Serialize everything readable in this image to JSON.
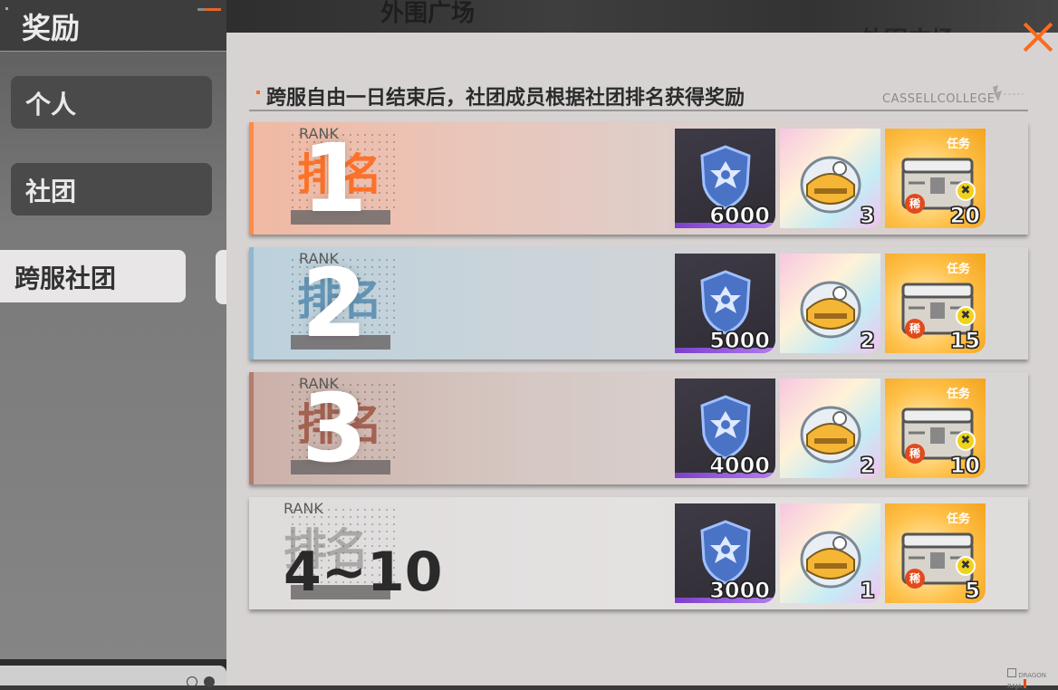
{
  "background": {
    "map_label_1": "外围广场",
    "map_label_2": "外围广场"
  },
  "sidebar": {
    "title": "奖励",
    "tabs": [
      {
        "label": "个人",
        "active": false
      },
      {
        "label": "社团",
        "active": false
      },
      {
        "label": "跨服社团",
        "active": true
      }
    ]
  },
  "header": {
    "description": "跨服自由一日结束后，社团成员根据社团排名获得奖励",
    "brand": "CASSELLCOLLEGE"
  },
  "item_labels": {
    "rare_tag": "稀",
    "task_tag": "任务"
  },
  "ranks": [
    {
      "rank_label": "RANK",
      "rank_name": "排名",
      "number": "1",
      "color": "#ff6a1c",
      "rewards": {
        "shield": "6000",
        "bag": "3",
        "chest": "20"
      }
    },
    {
      "rank_label": "RANK",
      "rank_name": "排名",
      "number": "2",
      "color": "#5b8fb0",
      "rewards": {
        "shield": "5000",
        "bag": "2",
        "chest": "15"
      }
    },
    {
      "rank_label": "RANK",
      "rank_name": "排名",
      "number": "3",
      "color": "#a05a48",
      "rewards": {
        "shield": "4000",
        "bag": "2",
        "chest": "10"
      }
    },
    {
      "rank_label": "RANK",
      "rank_name": "排名",
      "number": "4~10",
      "color": "#6d6969",
      "rewards": {
        "shield": "3000",
        "bag": "1",
        "chest": "5"
      }
    }
  ],
  "watermark": "DRAGON RAJA"
}
